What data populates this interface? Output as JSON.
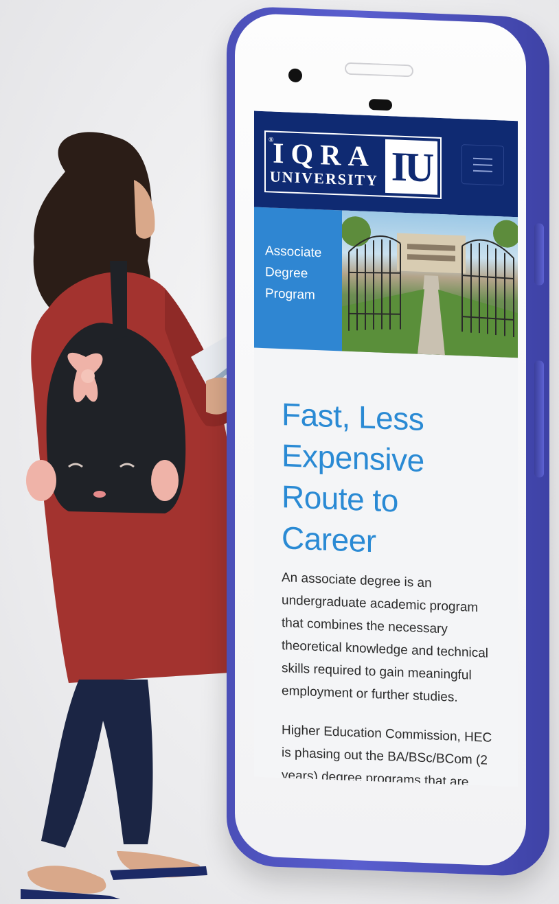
{
  "site": {
    "logo": {
      "reg_mark": "®",
      "line1": "IQRA",
      "line2": "UNIVERSITY",
      "mark": "IU"
    },
    "menu_icon": "hamburger-icon"
  },
  "hero": {
    "label": "Associate Degree Program",
    "image": "university-gate-photo"
  },
  "content": {
    "headline": "Fast, Less Expensive Route to Career",
    "paragraph1": "An associate degree is an undergraduate academic program that combines the necessary theoretical knowledge and technical skills required to gain meaningful employment or further studies.",
    "paragraph2": "Higher Education Commission, HEC is phasing out the BA/BSc/BCom (2 years) degree programs that are being"
  },
  "colors": {
    "header_bg": "#0f2a72",
    "hero_label_bg": "#2f86d2",
    "headline": "#2a8ad4",
    "phone_frame": "#4b4fb8"
  }
}
